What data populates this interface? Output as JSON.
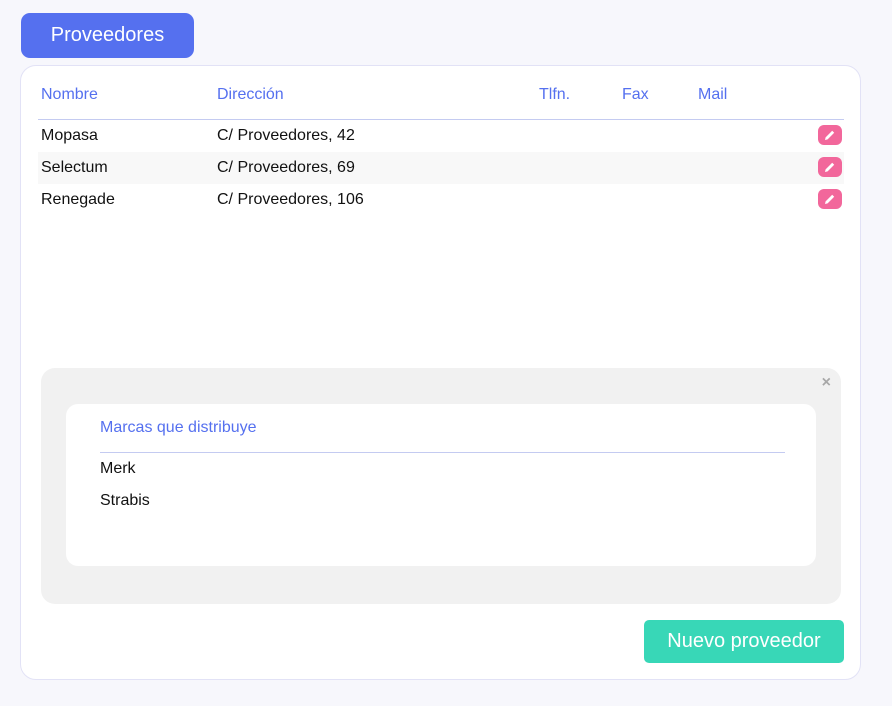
{
  "header": {
    "title": "Proveedores"
  },
  "table": {
    "columns": [
      "Nombre",
      "Dirección",
      "Tlfn.",
      "Fax",
      "Mail"
    ],
    "rows": [
      {
        "nombre": "Mopasa",
        "direccion": "C/ Proveedores, 42",
        "tlfn": "",
        "fax": "",
        "mail": ""
      },
      {
        "nombre": "Selectum",
        "direccion": "C/ Proveedores, 69",
        "tlfn": "",
        "fax": "",
        "mail": ""
      },
      {
        "nombre": "Renegade",
        "direccion": "C/ Proveedores, 106",
        "tlfn": "",
        "fax": "",
        "mail": ""
      }
    ],
    "edit_icon": "pencil-icon"
  },
  "detail": {
    "close_label": "×",
    "heading": "Marcas que distribuye",
    "brands": [
      "Merk",
      "Strabis"
    ]
  },
  "actions": {
    "new_label": "Nuevo proveedor"
  },
  "colors": {
    "accent": "#5570ef",
    "edit": "#f2679b",
    "new_button": "#38d7b7"
  }
}
